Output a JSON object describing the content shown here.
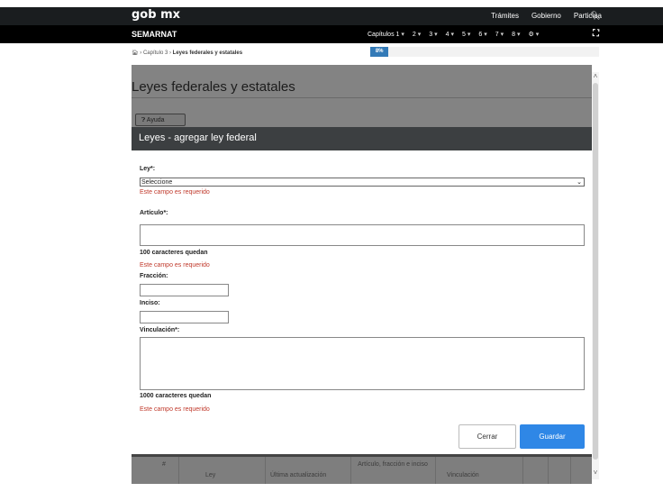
{
  "gob": {
    "logo": "gob mx",
    "links": [
      "Trámites",
      "Gobierno",
      "Participa"
    ],
    "search_icon": "search-icon"
  },
  "semarnat": {
    "brand": "SEMARNAT",
    "menu": [
      "Capítulos 1",
      "2",
      "3",
      "4",
      "5",
      "6",
      "7",
      "8"
    ],
    "settings_icon": "gear-icon",
    "expand_icon": "expand-icon"
  },
  "breadcrumb": {
    "home_icon": "home-icon",
    "parent": "Capítulo 3",
    "current": "Leyes federales y estatales"
  },
  "progress": {
    "label": "8%",
    "value": 8
  },
  "page": {
    "title": "Leyes federales y estatales",
    "help_label": "Ayuda"
  },
  "modal": {
    "title": "Leyes - agregar ley federal",
    "ley_label": "Ley*:",
    "ley_selected": "Seleccione",
    "ley_error": "Este campo es requerido",
    "articulo_label": "Artículo*:",
    "articulo_counter": "100 caracteres quedan",
    "articulo_error": "Este campo es requerido",
    "fraccion_label": "Fracción:",
    "inciso_label": "Inciso:",
    "vinculacion_label": "Vinculación*:",
    "vinculacion_counter": "1000 caracteres quedan",
    "vinculacion_error": "Este campo es requerido",
    "close_label": "Cerrar",
    "save_label": "Guardar"
  },
  "table": {
    "headers": [
      "#",
      "Ley",
      "Última actualización",
      "Artículo, fracción e inciso",
      "Vinculación"
    ]
  },
  "colors": {
    "header_bg": "#1a1d1f",
    "modal_header_bg": "#3c3f41",
    "error": "#c0392b",
    "primary": "#2f87e6",
    "progress": "#337ab7"
  }
}
